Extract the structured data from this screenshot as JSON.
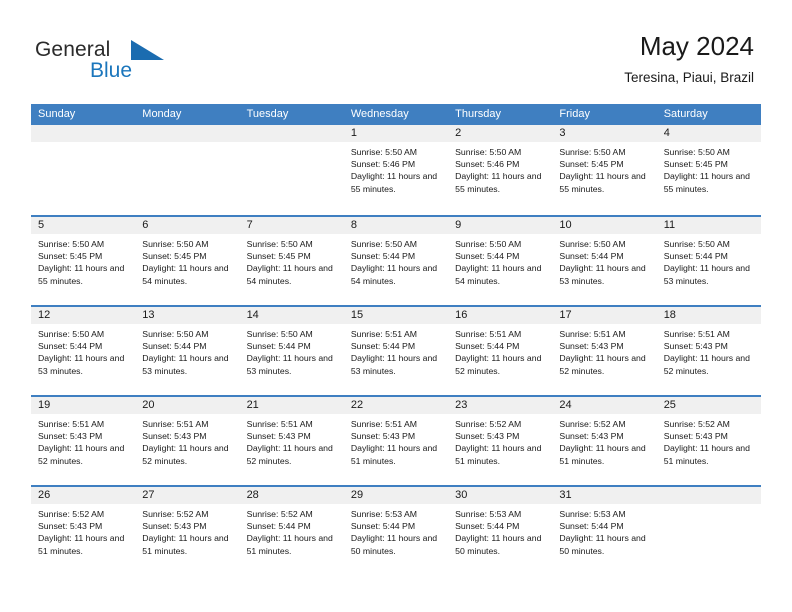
{
  "brand": {
    "name_top": "General",
    "name_bottom": "Blue",
    "triangle_icon": "blue-triangle-logo-mark",
    "color_text": "#2b2b2b",
    "color_blue": "#1b76bc"
  },
  "header": {
    "title": "May 2024",
    "subtitle": "Teresina, Piaui, Brazil"
  },
  "theme": {
    "header_bg": "#3f7fc1",
    "header_text": "#ffffff",
    "daynum_bg": "#f0f0f0",
    "row_rule": "#3f7fc1"
  },
  "weekdays": [
    "Sunday",
    "Monday",
    "Tuesday",
    "Wednesday",
    "Thursday",
    "Friday",
    "Saturday"
  ],
  "weeks": [
    [
      {
        "day": "",
        "sunrise": "",
        "sunset": "",
        "daylight": "",
        "blank": true
      },
      {
        "day": "",
        "sunrise": "",
        "sunset": "",
        "daylight": "",
        "blank": true
      },
      {
        "day": "",
        "sunrise": "",
        "sunset": "",
        "daylight": "",
        "blank": true
      },
      {
        "day": "1",
        "sunrise": "Sunrise: 5:50 AM",
        "sunset": "Sunset: 5:46 PM",
        "daylight": "Daylight: 11 hours and 55 minutes."
      },
      {
        "day": "2",
        "sunrise": "Sunrise: 5:50 AM",
        "sunset": "Sunset: 5:46 PM",
        "daylight": "Daylight: 11 hours and 55 minutes."
      },
      {
        "day": "3",
        "sunrise": "Sunrise: 5:50 AM",
        "sunset": "Sunset: 5:45 PM",
        "daylight": "Daylight: 11 hours and 55 minutes."
      },
      {
        "day": "4",
        "sunrise": "Sunrise: 5:50 AM",
        "sunset": "Sunset: 5:45 PM",
        "daylight": "Daylight: 11 hours and 55 minutes."
      }
    ],
    [
      {
        "day": "5",
        "sunrise": "Sunrise: 5:50 AM",
        "sunset": "Sunset: 5:45 PM",
        "daylight": "Daylight: 11 hours and 55 minutes."
      },
      {
        "day": "6",
        "sunrise": "Sunrise: 5:50 AM",
        "sunset": "Sunset: 5:45 PM",
        "daylight": "Daylight: 11 hours and 54 minutes."
      },
      {
        "day": "7",
        "sunrise": "Sunrise: 5:50 AM",
        "sunset": "Sunset: 5:45 PM",
        "daylight": "Daylight: 11 hours and 54 minutes."
      },
      {
        "day": "8",
        "sunrise": "Sunrise: 5:50 AM",
        "sunset": "Sunset: 5:44 PM",
        "daylight": "Daylight: 11 hours and 54 minutes."
      },
      {
        "day": "9",
        "sunrise": "Sunrise: 5:50 AM",
        "sunset": "Sunset: 5:44 PM",
        "daylight": "Daylight: 11 hours and 54 minutes."
      },
      {
        "day": "10",
        "sunrise": "Sunrise: 5:50 AM",
        "sunset": "Sunset: 5:44 PM",
        "daylight": "Daylight: 11 hours and 53 minutes."
      },
      {
        "day": "11",
        "sunrise": "Sunrise: 5:50 AM",
        "sunset": "Sunset: 5:44 PM",
        "daylight": "Daylight: 11 hours and 53 minutes."
      }
    ],
    [
      {
        "day": "12",
        "sunrise": "Sunrise: 5:50 AM",
        "sunset": "Sunset: 5:44 PM",
        "daylight": "Daylight: 11 hours and 53 minutes."
      },
      {
        "day": "13",
        "sunrise": "Sunrise: 5:50 AM",
        "sunset": "Sunset: 5:44 PM",
        "daylight": "Daylight: 11 hours and 53 minutes."
      },
      {
        "day": "14",
        "sunrise": "Sunrise: 5:50 AM",
        "sunset": "Sunset: 5:44 PM",
        "daylight": "Daylight: 11 hours and 53 minutes."
      },
      {
        "day": "15",
        "sunrise": "Sunrise: 5:51 AM",
        "sunset": "Sunset: 5:44 PM",
        "daylight": "Daylight: 11 hours and 53 minutes."
      },
      {
        "day": "16",
        "sunrise": "Sunrise: 5:51 AM",
        "sunset": "Sunset: 5:44 PM",
        "daylight": "Daylight: 11 hours and 52 minutes."
      },
      {
        "day": "17",
        "sunrise": "Sunrise: 5:51 AM",
        "sunset": "Sunset: 5:43 PM",
        "daylight": "Daylight: 11 hours and 52 minutes."
      },
      {
        "day": "18",
        "sunrise": "Sunrise: 5:51 AM",
        "sunset": "Sunset: 5:43 PM",
        "daylight": "Daylight: 11 hours and 52 minutes."
      }
    ],
    [
      {
        "day": "19",
        "sunrise": "Sunrise: 5:51 AM",
        "sunset": "Sunset: 5:43 PM",
        "daylight": "Daylight: 11 hours and 52 minutes."
      },
      {
        "day": "20",
        "sunrise": "Sunrise: 5:51 AM",
        "sunset": "Sunset: 5:43 PM",
        "daylight": "Daylight: 11 hours and 52 minutes."
      },
      {
        "day": "21",
        "sunrise": "Sunrise: 5:51 AM",
        "sunset": "Sunset: 5:43 PM",
        "daylight": "Daylight: 11 hours and 52 minutes."
      },
      {
        "day": "22",
        "sunrise": "Sunrise: 5:51 AM",
        "sunset": "Sunset: 5:43 PM",
        "daylight": "Daylight: 11 hours and 51 minutes."
      },
      {
        "day": "23",
        "sunrise": "Sunrise: 5:52 AM",
        "sunset": "Sunset: 5:43 PM",
        "daylight": "Daylight: 11 hours and 51 minutes."
      },
      {
        "day": "24",
        "sunrise": "Sunrise: 5:52 AM",
        "sunset": "Sunset: 5:43 PM",
        "daylight": "Daylight: 11 hours and 51 minutes."
      },
      {
        "day": "25",
        "sunrise": "Sunrise: 5:52 AM",
        "sunset": "Sunset: 5:43 PM",
        "daylight": "Daylight: 11 hours and 51 minutes."
      }
    ],
    [
      {
        "day": "26",
        "sunrise": "Sunrise: 5:52 AM",
        "sunset": "Sunset: 5:43 PM",
        "daylight": "Daylight: 11 hours and 51 minutes."
      },
      {
        "day": "27",
        "sunrise": "Sunrise: 5:52 AM",
        "sunset": "Sunset: 5:43 PM",
        "daylight": "Daylight: 11 hours and 51 minutes."
      },
      {
        "day": "28",
        "sunrise": "Sunrise: 5:52 AM",
        "sunset": "Sunset: 5:44 PM",
        "daylight": "Daylight: 11 hours and 51 minutes."
      },
      {
        "day": "29",
        "sunrise": "Sunrise: 5:53 AM",
        "sunset": "Sunset: 5:44 PM",
        "daylight": "Daylight: 11 hours and 50 minutes."
      },
      {
        "day": "30",
        "sunrise": "Sunrise: 5:53 AM",
        "sunset": "Sunset: 5:44 PM",
        "daylight": "Daylight: 11 hours and 50 minutes."
      },
      {
        "day": "31",
        "sunrise": "Sunrise: 5:53 AM",
        "sunset": "Sunset: 5:44 PM",
        "daylight": "Daylight: 11 hours and 50 minutes."
      },
      {
        "day": "",
        "sunrise": "",
        "sunset": "",
        "daylight": "",
        "blank": true
      }
    ]
  ]
}
